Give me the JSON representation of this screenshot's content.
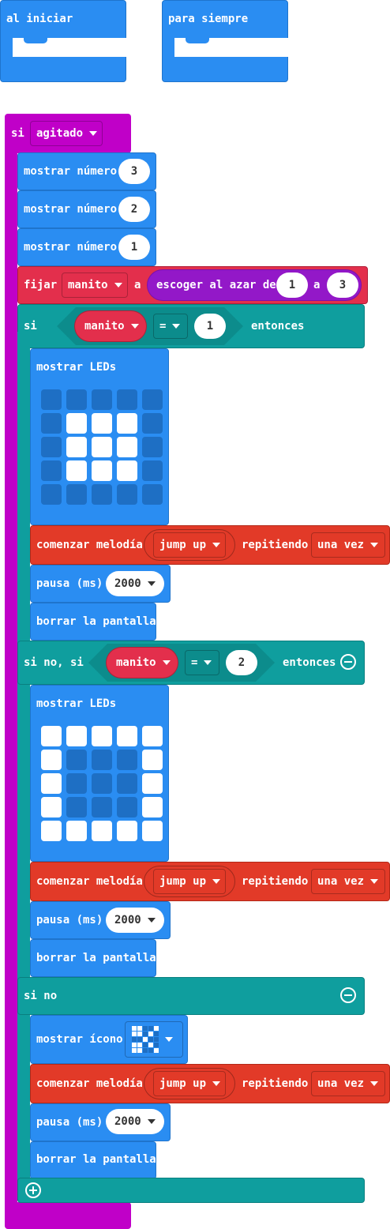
{
  "on_start": {
    "label": "al iniciar"
  },
  "forever": {
    "label": "para siempre"
  },
  "gesture_event": {
    "label": "si",
    "gesture": "agitado"
  },
  "show_number_label": "mostrar número",
  "show_numbers": [
    "3",
    "2",
    "1"
  ],
  "set_var": {
    "label": "fijar",
    "variable": "manito",
    "to_label": "a",
    "random": {
      "label": "escoger al azar de",
      "from": "1",
      "to_word": "a",
      "to": "3"
    }
  },
  "if_block": {
    "if_label": "si",
    "var": "manito",
    "op": "=",
    "value": "1",
    "then_label": "entonces",
    "elseif_label": "si no, si",
    "elseif_value": "2",
    "else_label": "si no"
  },
  "show_leds_label": "mostrar LEDs",
  "leds_1": [
    [
      0,
      0,
      0,
      0,
      0
    ],
    [
      0,
      1,
      1,
      1,
      0
    ],
    [
      0,
      1,
      1,
      1,
      0
    ],
    [
      0,
      1,
      1,
      1,
      0
    ],
    [
      0,
      0,
      0,
      0,
      0
    ]
  ],
  "leds_2": [
    [
      1,
      1,
      1,
      1,
      1
    ],
    [
      1,
      0,
      0,
      0,
      1
    ],
    [
      1,
      0,
      0,
      0,
      1
    ],
    [
      1,
      0,
      0,
      0,
      1
    ],
    [
      1,
      1,
      1,
      1,
      1
    ]
  ],
  "melody": {
    "label": "comenzar melodía",
    "tune": "jump up",
    "repeat_label": "repitiendo",
    "repeat": "una vez"
  },
  "pause": {
    "label": "pausa (ms)",
    "value": "2000"
  },
  "clear_label": "borrar la pantalla",
  "show_icon": {
    "label": "mostrar ícono",
    "icon": "scissors-icon"
  },
  "colors": {
    "basic": "#2a8df2",
    "input": "#c000c8",
    "variables": "#e32f4c",
    "math": "#9318c8",
    "logic": "#0f9e9e",
    "music": "#e23a28"
  }
}
